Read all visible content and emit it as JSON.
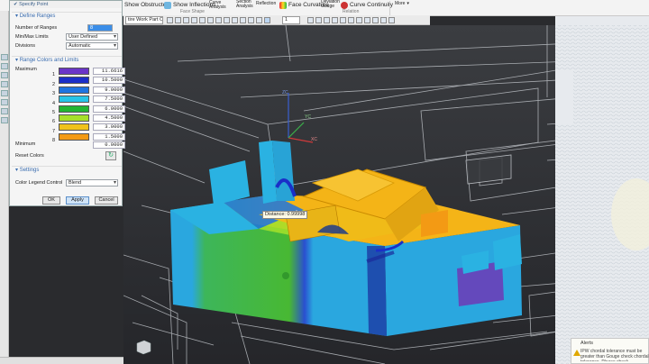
{
  "ribbon": {
    "specify_point": "Specify Point",
    "show_obstructed": "Show Obstructed",
    "show_inflections": "Show Inflections",
    "curve_analysis": "Curve Analysis",
    "section_analysis": "Section Analysis",
    "reflection": "Reflection",
    "face_curvature": "Face Curvature",
    "deviation_gauge": "Deviation Gauge",
    "curve_continuity": "Curve Continuity",
    "more": "More",
    "group_face_shape": "Face Shape",
    "group_relation": "Relation",
    "work_part_filter": "tire Work Part O",
    "layer_value": "1"
  },
  "dialog": {
    "define_ranges": "Define Ranges",
    "number_of_ranges_label": "Number of Ranges",
    "number_of_ranges_value": "8",
    "min_max_limits_label": "Min/Max Limits",
    "min_max_limits_value": "User Defined",
    "divisions_label": "Divisions",
    "divisions_value": "Automatic",
    "range_colors_title": "Range Colors and Limits",
    "maximum_label": "Maximum",
    "minimum_label": "Minimum",
    "reset_colors_label": "Reset Colors",
    "ranges": [
      {
        "idx": "",
        "color": "#6a35c8",
        "value": "11.6616"
      },
      {
        "idx": "1",
        "color": "#1a2fc8",
        "value": "10.5000"
      },
      {
        "idx": "2",
        "color": "#1e74e0",
        "value": "9.0000"
      },
      {
        "idx": "3",
        "color": "#26c4e8",
        "value": "7.5000"
      },
      {
        "idx": "4",
        "color": "#22b532",
        "value": "6.0000"
      },
      {
        "idx": "5",
        "color": "#a6e02a",
        "value": "4.5000"
      },
      {
        "idx": "6",
        "color": "#f0c21a",
        "value": "3.0000"
      },
      {
        "idx": "7",
        "color": "#f39a14",
        "value": "1.5000"
      },
      {
        "idx": "8",
        "color": "",
        "value": "0.0000"
      }
    ],
    "settings_title": "Settings",
    "color_legend_control_label": "Color Legend Control",
    "color_legend_control_value": "Blend",
    "ok": "OK",
    "apply": "Apply",
    "cancel": "Cancel"
  },
  "viewport": {
    "distance_tip": "Distance: 0.99998",
    "axis_x": "XC",
    "axis_y": "YC",
    "axis_z": "ZC"
  },
  "alert": {
    "title": "Alerts",
    "message": "IPW chordal tolerance must be greater than Gouge check chordal tolerance. Please check"
  },
  "colors": {
    "cyan": "#28b4e8",
    "green": "#3fb832",
    "yellow": "#f4b417",
    "navy": "#1a2a9a",
    "purple": "#6a3fb8"
  }
}
